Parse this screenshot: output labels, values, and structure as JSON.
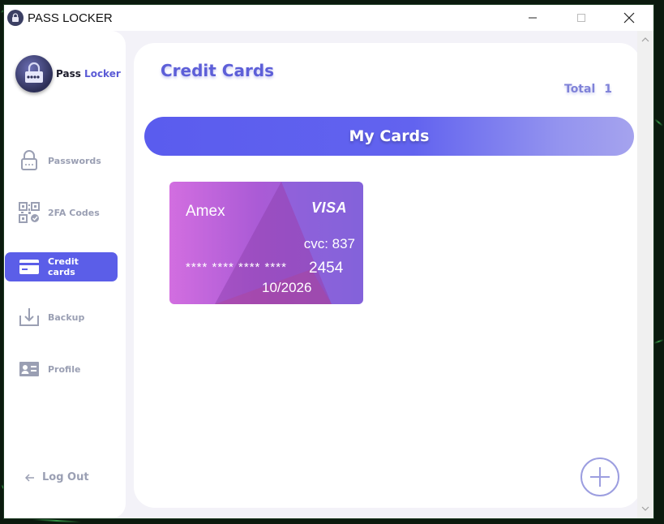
{
  "window": {
    "title": "PASS LOCKER",
    "controls": {
      "minimize": "minimize-icon",
      "maximize": "maximize-icon",
      "close": "close-icon"
    }
  },
  "sidebar": {
    "logo": {
      "pass": "Pass",
      "locker": "Locker"
    },
    "items": [
      {
        "label": "Passwords",
        "icon": "lock-icon"
      },
      {
        "label": "2FA Codes",
        "icon": "qr-code-icon"
      },
      {
        "label": "Credit cards",
        "icon": "credit-card-icon",
        "active": true
      },
      {
        "label": "Backup",
        "icon": "download-icon"
      },
      {
        "label": "Profile",
        "icon": "id-card-icon"
      }
    ],
    "logout": {
      "label": "Log Out",
      "icon": "arrow-left-icon"
    }
  },
  "main": {
    "title": "Credit Cards",
    "total_label": "Total",
    "total_value": "1",
    "section_title": "My Cards",
    "cards": [
      {
        "name": "Amex",
        "brand": "VISA",
        "cvc": "cvc: 837",
        "masked": "**** **** **** ****",
        "last4": "2454",
        "expiry": "10/2026"
      }
    ],
    "add_button_icon": "plus-icon"
  },
  "colors": {
    "accent": "#5b5ee8",
    "title": "#5d5fd8",
    "muted": "#9a9fb3",
    "card_gradient_start": "#d26ee0",
    "card_gradient_end": "#8e5fd8"
  }
}
